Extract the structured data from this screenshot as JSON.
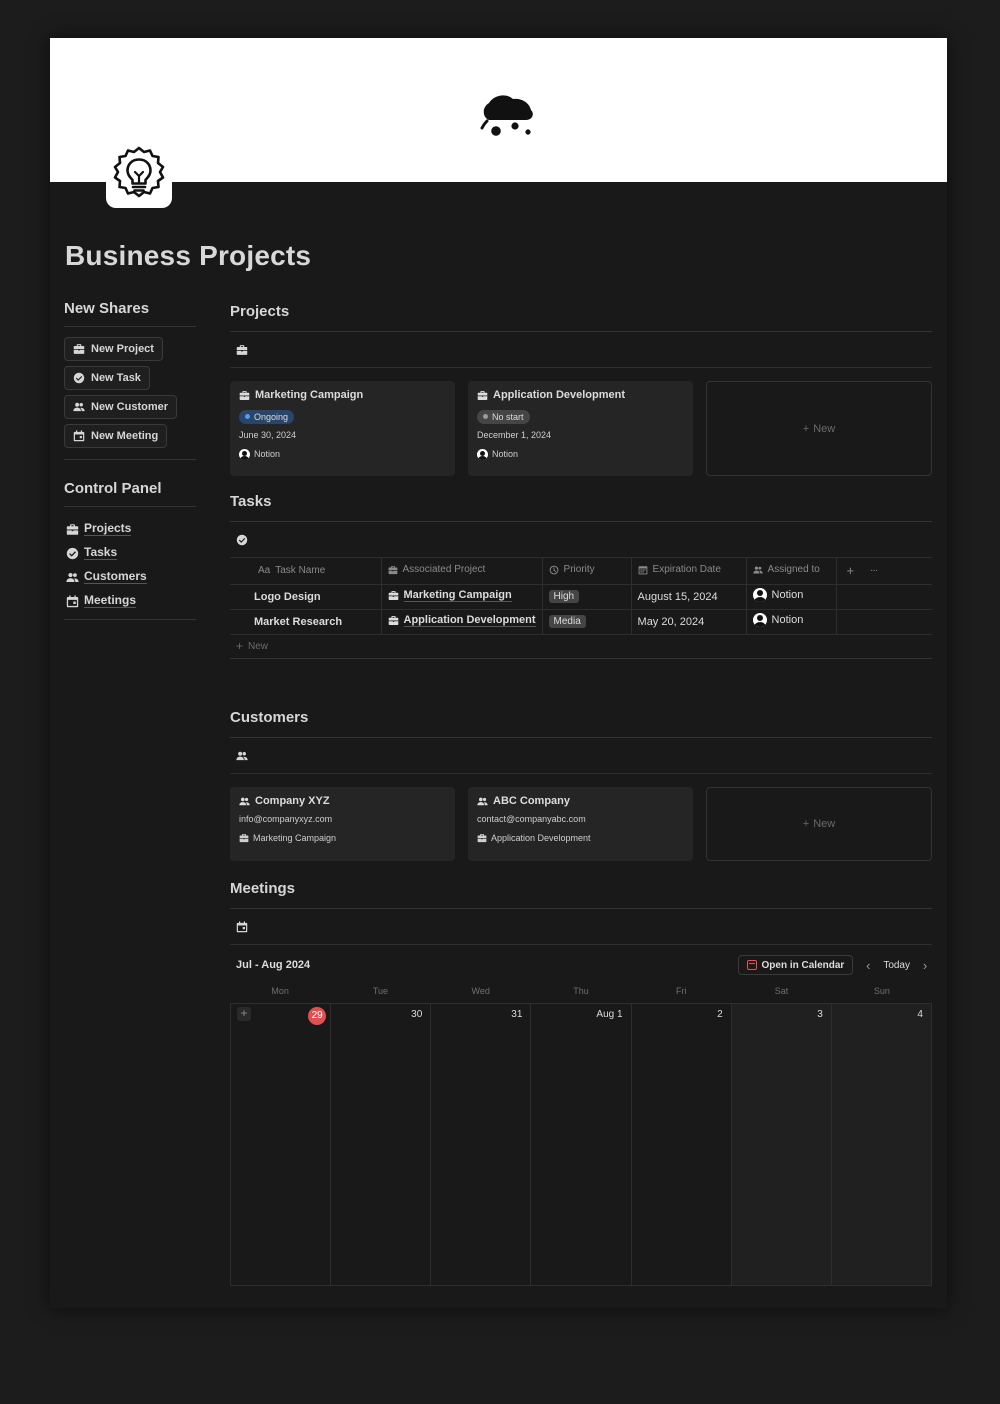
{
  "page": {
    "title": "Business Projects"
  },
  "new_shares": {
    "heading": "New Shares",
    "buttons": [
      "New Project",
      "New Task",
      "New Customer",
      "New Meeting"
    ]
  },
  "control_panel": {
    "heading": "Control Panel",
    "links": [
      "Projects",
      "Tasks",
      "Customers",
      "Meetings"
    ]
  },
  "projects": {
    "heading": "Projects",
    "cards": [
      {
        "title": "Marketing Campaign",
        "status": "Ongoing",
        "date": "June 30, 2024",
        "owner": "Notion"
      },
      {
        "title": "Application Development",
        "status": "No start",
        "date": "December 1, 2024",
        "owner": "Notion"
      }
    ],
    "new_label": "New"
  },
  "tasks": {
    "heading": "Tasks",
    "columns": {
      "name": "Task Name",
      "name_prefix": "Aa",
      "project": "Associated Project",
      "priority": "Priority",
      "date": "Expiration Date",
      "assigned": "Assigned to",
      "add": "+",
      "more": "···"
    },
    "rows": [
      {
        "name": "Logo Design",
        "project": "Marketing Campaign",
        "priority": "High",
        "date": "August 15, 2024",
        "assigned": "Notion"
      },
      {
        "name": "Market Research",
        "project": "Application Development",
        "priority": "Media",
        "date": "May 20, 2024",
        "assigned": "Notion"
      }
    ],
    "new_label": "New"
  },
  "customers": {
    "heading": "Customers",
    "cards": [
      {
        "title": "Company XYZ",
        "email": "info@companyxyz.com",
        "project": "Marketing Campaign"
      },
      {
        "title": "ABC Company",
        "email": "contact@companyabc.com",
        "project": "Application Development"
      }
    ],
    "new_label": "New"
  },
  "meetings": {
    "heading": "Meetings",
    "month_label": "Jul - Aug 2024",
    "open_calendar": "Open in Calendar",
    "today": "Today",
    "weekdays": [
      "Mon",
      "Tue",
      "Wed",
      "Thu",
      "Fri",
      "Sat",
      "Sun"
    ],
    "days": [
      "29",
      "30",
      "31",
      "Aug 1",
      "2",
      "3",
      "4"
    ],
    "today_index": 0
  },
  "colors": {
    "accent_today": "#e14f4f",
    "ongoing_pill": "#28456c",
    "page_bg": "#191919",
    "cover_bg": "#ffffff"
  },
  "icons": {
    "project": "briefcase-icon",
    "task": "check-circle-icon",
    "customer": "people-icon",
    "meeting": "calendar-icon",
    "page": "lightbulb-badge-icon"
  }
}
